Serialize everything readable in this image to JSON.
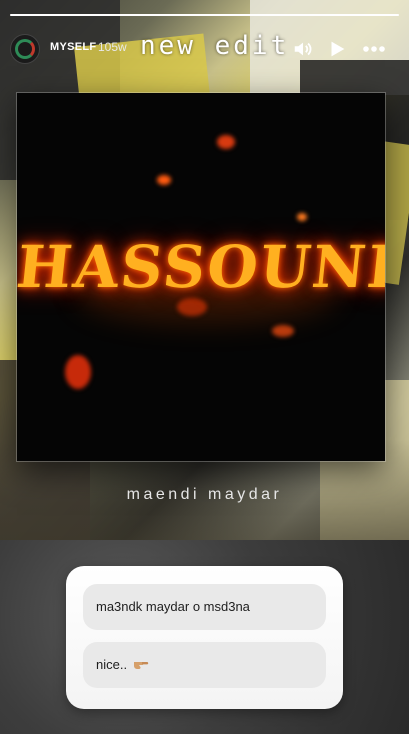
{
  "story": {
    "progress": 1.0,
    "username": "MYSELF",
    "posted_ago": "105w",
    "sticker_text": "new edit"
  },
  "cover": {
    "title_art": "HASSOUNI"
  },
  "song": {
    "title": "maendi maydar"
  },
  "poll": {
    "options": [
      {
        "label": "ma3ndk maydar o msd3na"
      },
      {
        "label": "nice.."
      }
    ]
  },
  "icons": {
    "volume": "volume-icon",
    "play": "play-icon",
    "more": "more-icon",
    "finger": "pointing-hand-icon"
  },
  "colors": {
    "fire": "#ff6a00",
    "progress": "#ffffff",
    "card": "#ffffff",
    "option": "#e9e9e9"
  }
}
